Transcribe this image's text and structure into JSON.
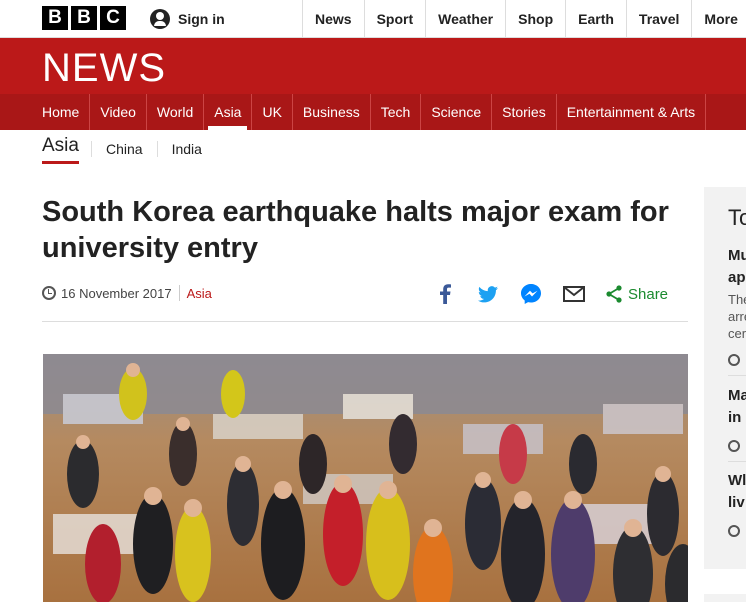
{
  "brand": {
    "letters": [
      "B",
      "B",
      "C"
    ],
    "section_word": "NEWS"
  },
  "account": {
    "signin_label": "Sign in"
  },
  "top_nav": [
    "News",
    "Sport",
    "Weather",
    "Shop",
    "Earth",
    "Travel",
    "More"
  ],
  "news_nav": [
    "Home",
    "Video",
    "World",
    "Asia",
    "UK",
    "Business",
    "Tech",
    "Science",
    "Stories",
    "Entertainment & Arts"
  ],
  "news_nav_active": "Asia",
  "sub_nav": {
    "current": "Asia",
    "items": [
      "China",
      "India"
    ]
  },
  "article": {
    "headline": "South Korea earthquake halts major exam for university entry",
    "date": "16 November 2017",
    "section": "Asia",
    "share_label": "Share",
    "image_alt": "People sheltering in a gymnasium"
  },
  "sidebar": {
    "title": "To",
    "items": [
      {
        "title": "Mu",
        "title2": "ap",
        "desc": [
          "The",
          "arre",
          "cer"
        ]
      },
      {
        "title": "Ma",
        "title2": "in"
      },
      {
        "title": "Wl",
        "title2": "liv"
      }
    ]
  },
  "colors": {
    "brand_red": "#bb1919",
    "nav_red": "#a91717",
    "share_green": "#1b8a2f",
    "facebook": "#3b5998",
    "twitter": "#1da1f2",
    "messenger": "#0084ff"
  },
  "icons": [
    "person-icon",
    "clock-icon",
    "facebook-icon",
    "twitter-icon",
    "messenger-icon",
    "email-icon",
    "share-icon"
  ]
}
